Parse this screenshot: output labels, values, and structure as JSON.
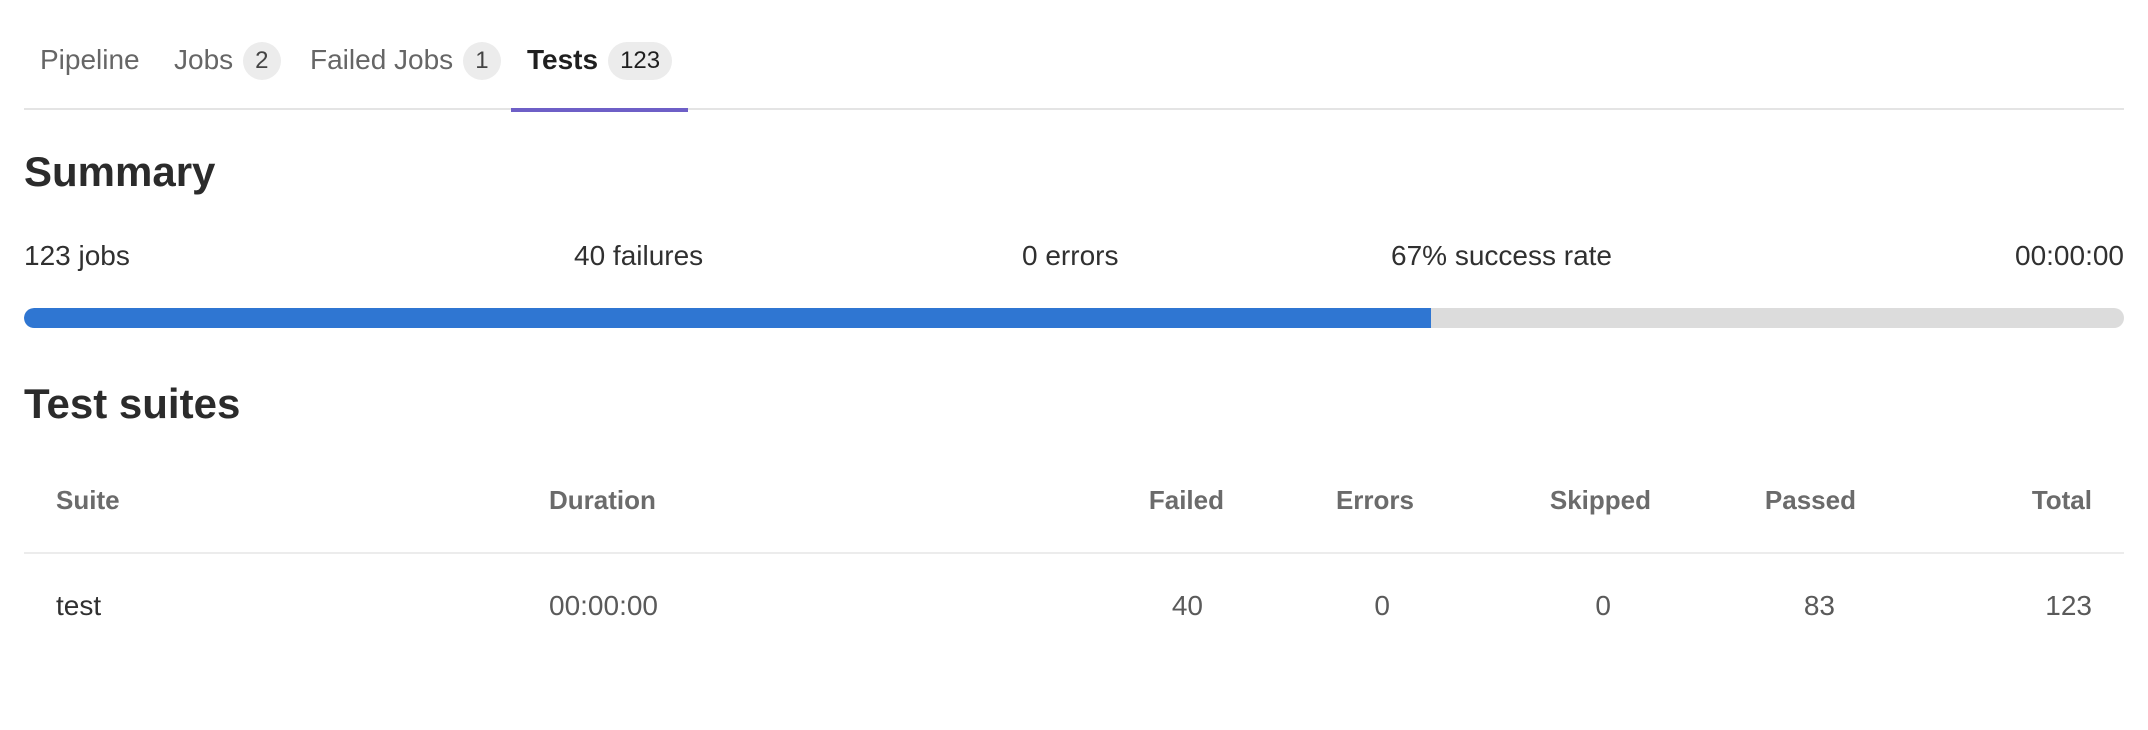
{
  "tabs": [
    {
      "label": "Pipeline"
    },
    {
      "label": "Jobs",
      "count": "2"
    },
    {
      "label": "Failed Jobs",
      "count": "1"
    },
    {
      "label": "Tests",
      "count": "123",
      "active": true
    }
  ],
  "summary": {
    "title": "Summary",
    "jobs": "123 jobs",
    "failures": "40 failures",
    "errors": "0 errors",
    "success_rate": "67% success rate",
    "duration": "00:00:00",
    "progress_percent": 67,
    "progress_color": "#2f76d2",
    "progress_track_color": "#dcdcdc"
  },
  "test_suites": {
    "title": "Test suites",
    "columns": [
      "Suite",
      "Duration",
      "Failed",
      "Errors",
      "Skipped",
      "Passed",
      "Total"
    ],
    "rows": [
      {
        "suite": "test",
        "duration": "00:00:00",
        "failed": "40",
        "errors": "0",
        "skipped": "0",
        "passed": "83",
        "total": "123"
      }
    ]
  },
  "colors": {
    "active_tab_indicator": "#6e5fc7"
  }
}
